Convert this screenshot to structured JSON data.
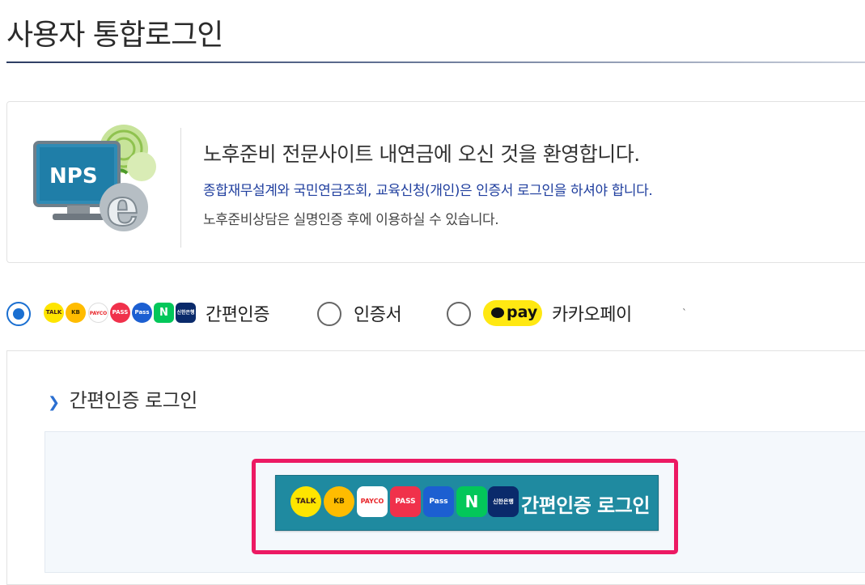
{
  "page": {
    "title": "사용자 통합로그인"
  },
  "welcome": {
    "logo_text": "NPS",
    "title": "노후준비 전문사이트 내연금에 오신 것을 환영합니다.",
    "notice": "종합재무설계와 국민연금조회, 교육신청(개인)은 인증서 로그인을 하셔야 합니다.",
    "sub": "노후준비상담은 실명인증 후에 이용하실 수 있습니다."
  },
  "methods": {
    "simple": {
      "label": "간편인증",
      "selected": true
    },
    "cert": {
      "label": "인증서",
      "selected": false
    },
    "kakaopay": {
      "label": "카카오페이",
      "badge": "pay",
      "selected": false
    }
  },
  "providers": [
    {
      "name": "kakaotalk",
      "text": "TALK",
      "color": "#fee500",
      "fg": "#3a1d1d"
    },
    {
      "name": "kb",
      "text": "KB",
      "color": "#ffbc00",
      "fg": "#3a2d00"
    },
    {
      "name": "payco",
      "text": "PAYCO",
      "color": "#ffffff",
      "fg": "#e8262b"
    },
    {
      "name": "pass",
      "text": "PASS",
      "color": "#f0314b",
      "fg": "#ffffff"
    },
    {
      "name": "samsung-pass",
      "text": "Pass",
      "color": "#1c5fd1",
      "fg": "#ffffff"
    },
    {
      "name": "naver",
      "text": "N",
      "color": "#03c75a",
      "fg": "#ffffff"
    },
    {
      "name": "shinhan",
      "text": "신한은행",
      "color": "#0a2a6b",
      "fg": "#ffffff"
    }
  ],
  "login_section": {
    "title": "간편인증 로그인",
    "button_label": "간편인증 로그인"
  },
  "colors": {
    "accent_blue": "#1a6fd1",
    "button_teal": "#1f8aa0",
    "highlight_pink": "#ec1a63",
    "kakao_yellow": "#ffe812"
  }
}
